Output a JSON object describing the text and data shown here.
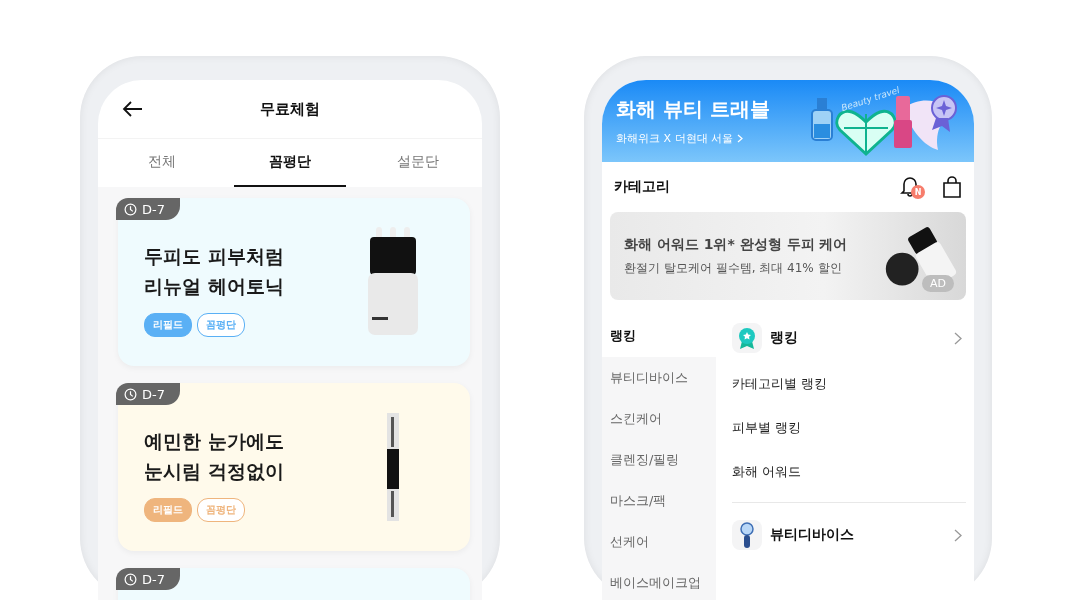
{
  "trial_screen": {
    "header": {
      "title": "무료체험"
    },
    "tabs": [
      {
        "label": "전체",
        "selected": false
      },
      {
        "label": "꼼평단",
        "selected": true
      },
      {
        "label": "설문단",
        "selected": false
      }
    ],
    "cards": [
      {
        "deadline": "D-7",
        "title_lines": [
          "두피도 피부처럼",
          "리뉴얼 헤어토닉"
        ],
        "color": "#effbfe",
        "tags": [
          {
            "label": "리필드",
            "kind": "filled",
            "color": "#5ab0f5"
          },
          {
            "label": "꼼평단",
            "kind": "outline",
            "color": "#5ab0f5"
          }
        ]
      },
      {
        "deadline": "D-7",
        "title_lines": [
          "예민한 눈가에도",
          "눈시림 걱정없이"
        ],
        "color": "#fffaeb",
        "tags": [
          {
            "label": "리필드",
            "kind": "filled",
            "color": "#efb57d"
          },
          {
            "label": "꼼평단",
            "kind": "outline",
            "color": "#efb57d"
          }
        ]
      },
      {
        "deadline": "D-7",
        "color": "#effbfe"
      }
    ]
  },
  "category_screen": {
    "banner": {
      "title": "화해 뷰티 트래블",
      "subtitle": "화해위크 X 더현대 서울",
      "art_text": "Beauty travel"
    },
    "header": {
      "title": "카테고리",
      "notification_badge": "N"
    },
    "ad": {
      "title": "화해 어워드 1위* 완성형 두피 케어",
      "subtitle": "환절기 탈모케어 필수템, 최대 41% 할인",
      "badge": "AD"
    },
    "sidebar": {
      "items": [
        {
          "label": "랭킹",
          "selected": true
        },
        {
          "label": "뷰티디바이스",
          "selected": false
        },
        {
          "label": "스킨케어",
          "selected": false
        },
        {
          "label": "클렌징/필링",
          "selected": false
        },
        {
          "label": "마스크/팩",
          "selected": false
        },
        {
          "label": "선케어",
          "selected": false
        },
        {
          "label": "베이스메이크업",
          "selected": false
        }
      ]
    },
    "sections": [
      {
        "title": "랭킹",
        "links": [
          "카테고리별 랭킹",
          "피부별 랭킹",
          "화해 어워드"
        ]
      },
      {
        "title": "뷰티디바이스"
      }
    ]
  }
}
